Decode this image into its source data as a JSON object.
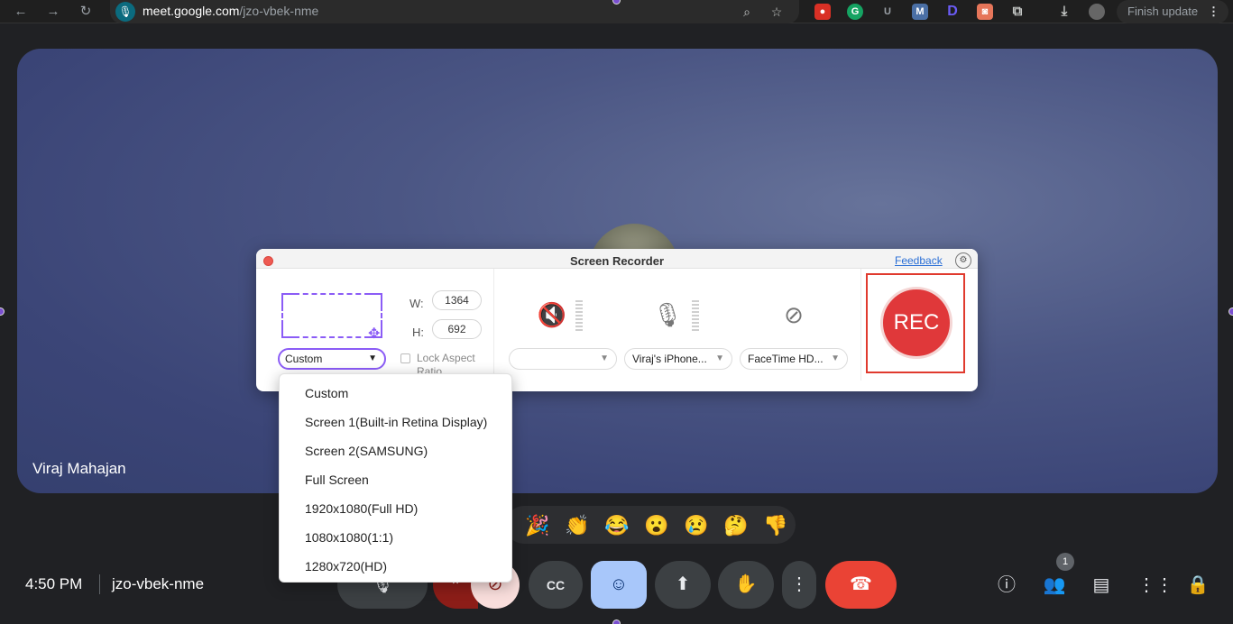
{
  "browser": {
    "url_host": "meet.google.com",
    "url_path": "/jzo-vbek-nme",
    "finish_update": "Finish update",
    "extensions": [
      "G",
      "U",
      "M",
      "D"
    ]
  },
  "meeting": {
    "participant_name": "Viraj Mahajan",
    "time": "4:50 PM",
    "code": "jzo-vbek-nme",
    "people_count": "1"
  },
  "reactions": [
    "🎉",
    "👏",
    "😂",
    "😮",
    "😢",
    "🤔",
    "👎"
  ],
  "recorder": {
    "title": "Screen Recorder",
    "feedback": "Feedback",
    "width_label": "W:",
    "width_value": "1364",
    "height_label": "H:",
    "height_value": "692",
    "preset_selected": "Custom",
    "lock_aspect_label": "Lock Aspect Ratio",
    "audio_device": "",
    "mic_device": "Viraj's iPhone...",
    "camera_device": "FaceTime HD...",
    "rec_label": "REC"
  },
  "dropdown": {
    "options": [
      "Custom",
      "Screen 1(Built-in Retina Display)",
      "Screen 2(SAMSUNG)",
      "Full Screen",
      "1920x1080(Full HD)",
      "1080x1080(1:1)",
      "1280x720(HD)"
    ]
  },
  "colors": {
    "accent_purple": "#8b5cf6",
    "rec_red": "#e0383a",
    "hangup_red": "#ea4335"
  }
}
